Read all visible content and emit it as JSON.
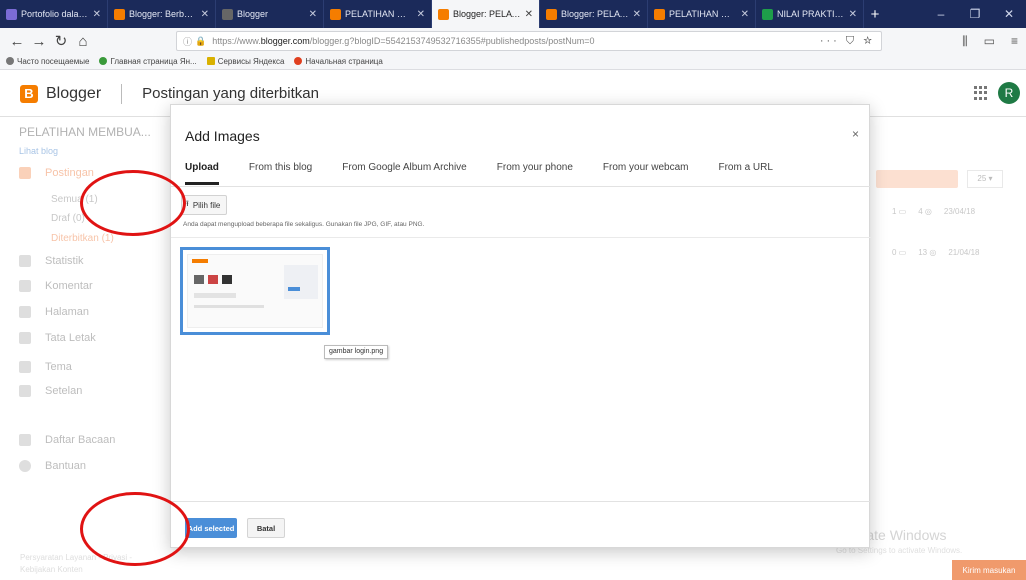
{
  "browser": {
    "tabs": [
      {
        "title": "Portofolio dalam Bl",
        "color": "#7b6bd6",
        "active": false
      },
      {
        "title": "Blogger: Berbagai L",
        "color": "#f57d00",
        "active": false
      },
      {
        "title": "Blogger",
        "color": "#666666",
        "active": false
      },
      {
        "title": "PELATIHAN MEMBUA",
        "color": "#f57d00",
        "active": false
      },
      {
        "title": "Blogger: PELATIHAN",
        "color": "#f57d00",
        "active": true
      },
      {
        "title": "Blogger: PELATIHA",
        "color": "#f57d00",
        "active": false
      },
      {
        "title": "PELATIHAN MEMBU",
        "color": "#f57d00",
        "active": false
      },
      {
        "title": "NILAI PRAKTIKUM",
        "color": "#1e9e4a",
        "active": false
      }
    ],
    "url_prefix": "https://www.",
    "url_domain": "blogger.com",
    "url_rest": "/blogger.g?blogID=5542153749532716355#publishedposts/postNum=0",
    "page_actions": "··· ⛉ ☆",
    "bookmarks": [
      "Часто посещаемые",
      "Главная страница Ян...",
      "Сервисы Яндекса",
      "Начальная страница"
    ]
  },
  "app": {
    "brand": "Blogger",
    "page_title": "Postingan yang diterbitkan",
    "avatar_initial": "R"
  },
  "sidebar": {
    "blog_name": "PELATIHAN MEMBUA...",
    "view_blog": "Lihat blog",
    "posts_label": "Postingan",
    "sub_items": [
      "Semua (1)",
      "Draf (0)",
      "Diterbitkan (1)"
    ],
    "items": [
      "Statistik",
      "Komentar",
      "Halaman",
      "Tata Letak",
      "Tema",
      "Setelan"
    ],
    "items2": [
      "Daftar Bacaan",
      "Bantuan"
    ],
    "footer": "Persyaratan Layanan - Privasi - Kebijakan Konten"
  },
  "background": {
    "per_page": "25 ▾",
    "rows": [
      {
        "a": "1 ▭",
        "b": "4 ◎",
        "date": "23/04/18"
      },
      {
        "a": "0 ▭",
        "b": "13 ◎",
        "date": "21/04/18"
      }
    ],
    "watermark_title": "Activate Windows",
    "watermark_sub": "Go to Settings to activate Windows.",
    "feedback": "Kirim masukan"
  },
  "dialog": {
    "title": "Add Images",
    "close": "×",
    "tabs": [
      "Upload",
      "From this blog",
      "From Google Album Archive",
      "From your phone",
      "From your webcam",
      "From a URL"
    ],
    "choose_file": "Pilih file",
    "hint": "Anda dapat mengupload beberapa file sekaligus. Gunakan file JPG, GIF, atau PNG.",
    "thumb_caption": "gambar login.png",
    "add_selected": "Add selected",
    "cancel": "Batal"
  },
  "colors": {
    "accent": "#4a8ed8",
    "brand": "#f57d00",
    "annotation": "#e01313"
  }
}
